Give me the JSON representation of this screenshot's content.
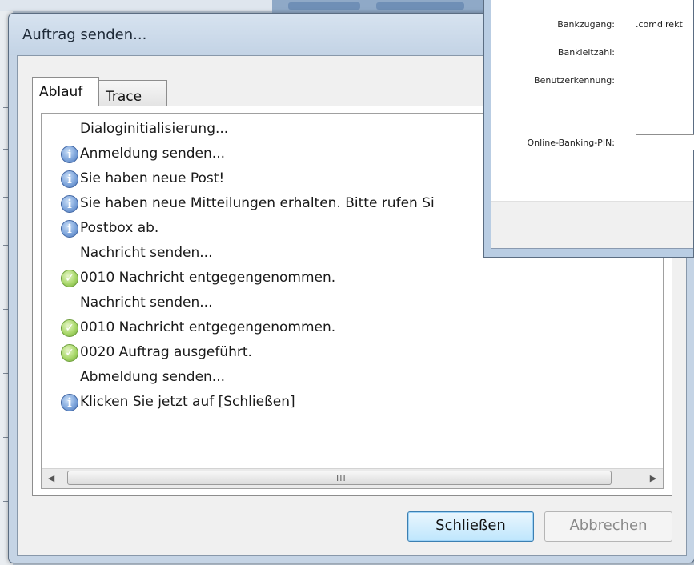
{
  "dialog": {
    "title": "Auftrag senden...",
    "tabs": [
      {
        "label": "Ablauf",
        "active": true
      },
      {
        "label": "Trace",
        "active": false
      }
    ],
    "log": [
      {
        "icon": "none",
        "text": "Dialoginitialisierung..."
      },
      {
        "icon": "info",
        "text": "Anmeldung senden..."
      },
      {
        "icon": "info",
        "text": "Sie haben neue Post!"
      },
      {
        "icon": "info",
        "text": "Sie haben neue Mitteilungen erhalten. Bitte rufen Si"
      },
      {
        "icon": "info",
        "text": "Postbox ab."
      },
      {
        "icon": "none",
        "text": "Nachricht senden..."
      },
      {
        "icon": "ok",
        "text": "0010 Nachricht entgegengenommen."
      },
      {
        "icon": "none",
        "text": "Nachricht senden..."
      },
      {
        "icon": "ok",
        "text": "0010 Nachricht entgegengenommen."
      },
      {
        "icon": "ok",
        "text": "0020 Auftrag ausgeführt."
      },
      {
        "icon": "none",
        "text": "Abmeldung senden..."
      },
      {
        "icon": "info",
        "text": "Klicken Sie jetzt auf [Schließen]"
      }
    ],
    "scrollbar": {
      "grip": "III",
      "left_arrow": "◀",
      "right_arrow": "▶"
    },
    "buttons": {
      "close": "Schließen",
      "cancel": "Abbrechen"
    }
  },
  "bank_window": {
    "fields": {
      "bankzugang_label": "Bankzugang:",
      "bankzugang_value": ".comdirekt",
      "bankleitzahl_label": "Bankleitzahl:",
      "benutzerkennung_label": "Benutzerkennung:",
      "pin_label": "Online-Banking-PIN:",
      "pin_value": ""
    }
  },
  "colors": {
    "accent": "#3c7fb1",
    "info_icon": "#4a74b8",
    "ok_icon": "#6fa838"
  }
}
